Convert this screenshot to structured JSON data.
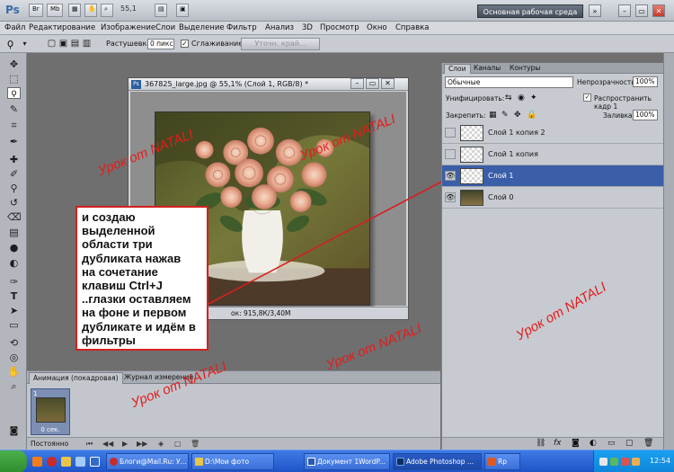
{
  "app": {
    "logo": "Ps",
    "zoom": "55,1",
    "workspace_label": "Основная рабочая среда",
    "top_buttons": [
      "Br",
      "Mb"
    ],
    "window_controls": [
      "»",
      "–",
      "▭",
      "✕"
    ]
  },
  "menu": [
    "Файл",
    "Редактирование",
    "Изображение",
    "Слои",
    "Выделение",
    "Фильтр",
    "Анализ",
    "3D",
    "Просмотр",
    "Окно",
    "Справка"
  ],
  "options": {
    "feather_label": "Растушевка:",
    "feather_value": "0 пикс",
    "antialias_label": "Сглаживание",
    "refine_label": "Уточн. край..."
  },
  "document": {
    "title": "367825_large.jpg @ 55,1% (Слой 1, RGB/8) *",
    "status": "ок: 915,8К/3,40М",
    "window_controls": [
      "–",
      "▭",
      "✕"
    ]
  },
  "callout": {
    "lines": [
      "и создаю",
      "выделенной",
      "области  три",
      "дубликата нажав",
      "на сочетание",
      "клавиш Ctrl+J",
      "..глазки оставляем",
      "на фоне и первом",
      "дубликате и идём в",
      "фильтры"
    ]
  },
  "watermark": "Урок от  NATALI",
  "animation": {
    "tabs": [
      "Анимация (покадровая)",
      "Журнал измерений"
    ],
    "frame_number": "1",
    "frame_delay": "0 сек.",
    "loop": "Постоянно"
  },
  "layers_panel": {
    "tabs": [
      "Слои",
      "Каналы",
      "Контуры"
    ],
    "blend_mode": "Обычные",
    "opacity_label": "Непрозрачность:",
    "opacity_value": "100%",
    "unify_label": "Унифицировать:",
    "propagate_label": "Распространить кадр 1",
    "lock_label": "Закрепить:",
    "fill_label": "Заливка:",
    "fill_value": "100%",
    "layers": [
      {
        "name": "Слой 1 копия 2",
        "visible": false,
        "selected": false
      },
      {
        "name": "Слой 1 копия",
        "visible": false,
        "selected": false
      },
      {
        "name": "Слой 1",
        "visible": true,
        "selected": true
      },
      {
        "name": "Слой 0",
        "visible": true,
        "selected": false
      }
    ]
  },
  "taskbar": {
    "tasks": [
      "Блоги@Mail.Ru: У...",
      "D:\\Мои фото",
      "Документ 1WordP...",
      "Adobe Photoshop ...",
      "Rp"
    ],
    "clock": "12:54"
  },
  "colors": {
    "accent": "#3a5fa8",
    "watermark": "#e21d1d",
    "foreground_swatch": "#e8171d",
    "callout_border": "#d42020"
  }
}
